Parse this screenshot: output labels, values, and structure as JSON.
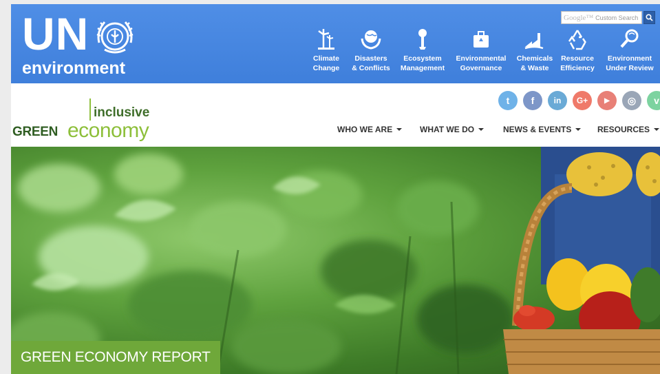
{
  "un_header": {
    "logo_letters": "UN",
    "logo_subtitle": "environment",
    "search": {
      "brand": "Google™",
      "placeholder": "Custom Search"
    },
    "nav": [
      {
        "line1": "Climate",
        "line2": "Change",
        "icon": "wind-turbine-icon"
      },
      {
        "line1": "Disasters",
        "line2": "& Conflicts",
        "icon": "globe-hands-icon"
      },
      {
        "line1": "Ecosystem",
        "line2": "Management",
        "icon": "tree-icon"
      },
      {
        "line1": "Environmental",
        "line2": "Governance",
        "icon": "briefcase-icon"
      },
      {
        "line1": "Chemicals",
        "line2": "& Waste",
        "icon": "factory-icon"
      },
      {
        "line1": "Resource",
        "line2": "Efficiency",
        "icon": "recycle-icon"
      },
      {
        "line1": "Environment",
        "line2": "Under Review",
        "icon": "magnifier-icon"
      }
    ]
  },
  "site_header": {
    "logo": {
      "inclusive": "inclusive",
      "green": "GREEN",
      "economy": "economy"
    },
    "social": [
      {
        "name": "twitter-icon",
        "glyph": "t",
        "color": "#6fb2e8"
      },
      {
        "name": "facebook-icon",
        "glyph": "f",
        "color": "#7d96c8"
      },
      {
        "name": "linkedin-icon",
        "glyph": "in",
        "color": "#6aaad6"
      },
      {
        "name": "googleplus-icon",
        "glyph": "G+",
        "color": "#ef7a6a"
      },
      {
        "name": "youtube-icon",
        "glyph": "▶",
        "color": "#e88077"
      },
      {
        "name": "instagram-icon",
        "glyph": "◎",
        "color": "#9aa6b7"
      },
      {
        "name": "vimeo-icon",
        "glyph": "v",
        "color": "#7dd3a0"
      }
    ],
    "nav": [
      {
        "label": "WHO WE ARE"
      },
      {
        "label": "WHAT WE DO"
      },
      {
        "label": "NEWS & EVENTS"
      },
      {
        "label": "RESOURCES"
      }
    ]
  },
  "hero": {
    "caption": "GREEN ECONOMY REPORT"
  }
}
